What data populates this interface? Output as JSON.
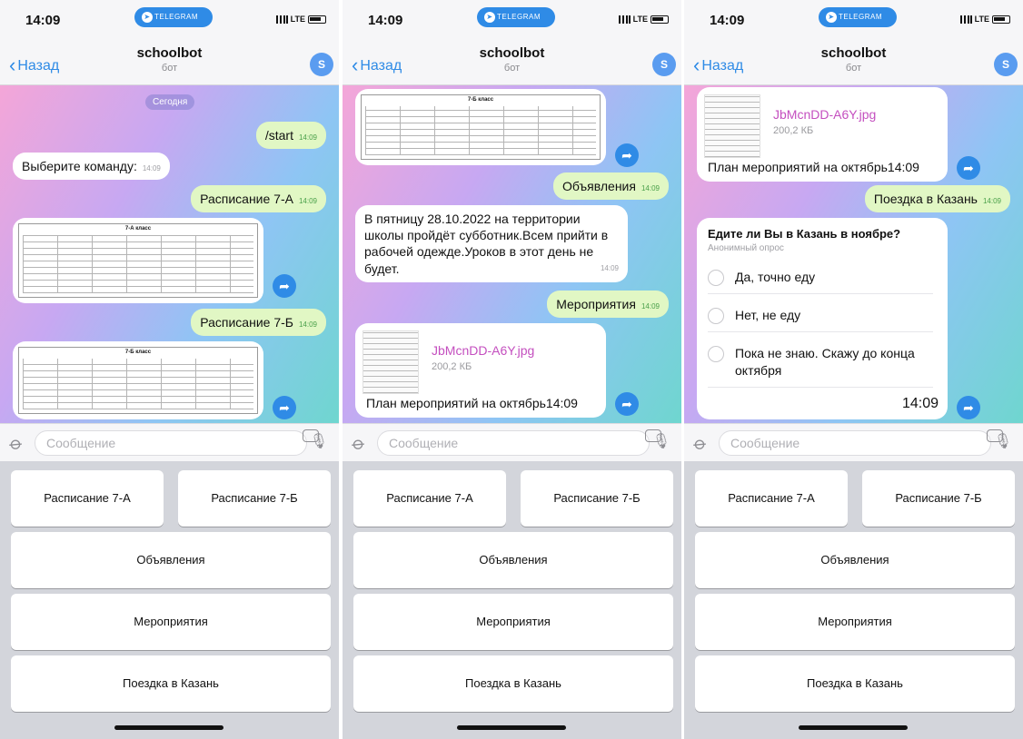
{
  "status": {
    "time": "14:09",
    "pill": "TELEGRAM",
    "network": "LTE"
  },
  "header": {
    "back": "Назад",
    "title": "schoolbot",
    "subtitle": "бот",
    "avatar": "S"
  },
  "date_chip": "Сегодня",
  "messages": {
    "start": "/start",
    "choose": "Выберите команду:",
    "sched_a": "Расписание 7-А",
    "sched_b": "Расписание 7-Б",
    "announce": "Объявления",
    "announce_text": "В пятницу 28.10.2022 на территории школы пройдёт субботник.Всем прийти в рабочей одежде.Уроков в этот день не будет.",
    "events": "Мероприятия",
    "file_name": "JbMcnDD-A6Y.jpg",
    "file_size": "200,2 КБ",
    "events_caption": "План мероприятий на октябрь",
    "kazan": "Поездка в Казань",
    "time": "14:09"
  },
  "tables": {
    "a_title": "7-А класс",
    "b_title": "7-Б класс"
  },
  "poll": {
    "question": "Едите ли Вы в Казань в ноябре?",
    "type": "Анонимный опрос",
    "options": [
      "Да, точно еду",
      "Нет, не еду",
      "Пока не знаю. Скажу до конца октября"
    ]
  },
  "input": {
    "placeholder": "Сообщение"
  },
  "keyboard": {
    "sched_a": "Расписание 7-А",
    "sched_b": "Расписание 7-Б",
    "announce": "Объявления",
    "events": "Мероприятия",
    "kazan": "Поездка в Казань"
  },
  "colors": {
    "accent": "#2f8be6",
    "outgoing": "#e1f7c4",
    "file_link": "#c44fbf"
  },
  "icons": [
    "telegram-icon",
    "back-chevron-icon",
    "forward-icon",
    "attach-icon",
    "keyboard-icon",
    "mic-icon"
  ]
}
